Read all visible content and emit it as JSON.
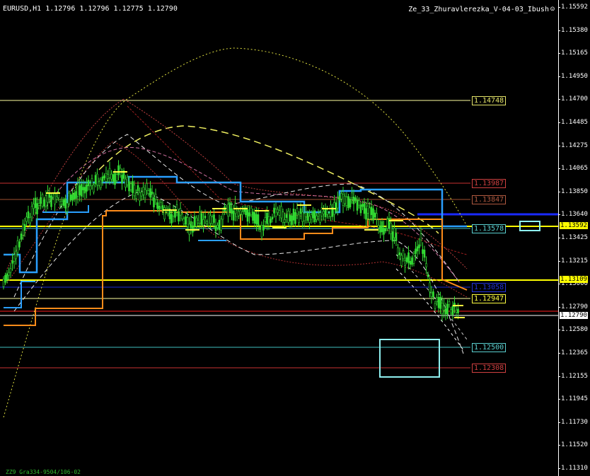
{
  "header": {
    "symbol_info": "EURUSD,H1  1.12796 1.12796 1.12775 1.12790",
    "indicator_name": "Ze_33_Zhuravlerezka_V-04-03_Ibush",
    "smiley_icon": "smiley-icon"
  },
  "footer": {
    "text": "ZZ9 Gra334-9504/106-02"
  },
  "price_axis": {
    "ticks": [
      "1.15592",
      "1.15380",
      "1.15165",
      "1.14950",
      "1.14700",
      "1.14485",
      "1.14275",
      "1.14065",
      "1.13850",
      "1.13640",
      "1.13425",
      "1.13215",
      "1.13000",
      "1.12790",
      "1.12580",
      "1.12365",
      "1.12155",
      "1.11945",
      "1.11730",
      "1.11520",
      "1.11310"
    ],
    "tag_high": "1.13592",
    "tag_yellow": "1.13109",
    "tag_current": "1.12790"
  },
  "level_labels": [
    {
      "text": "1.14748",
      "color": "#e6e66a"
    },
    {
      "text": "1.13987",
      "color": "#d04040"
    },
    {
      "text": "1.13847",
      "color": "#b05a40"
    },
    {
      "text": "1.13578",
      "color": "#5ad0d0"
    },
    {
      "text": "1.13058",
      "color": "#2233dd"
    },
    {
      "text": "1.12947",
      "color": "#ffff40"
    },
    {
      "text": "1.12500",
      "color": "#5ad0d0"
    },
    {
      "text": "1.12308",
      "color": "#d04040"
    }
  ],
  "colors": {
    "background": "#000000",
    "candles": "#33dd33",
    "grid": "#ffffff",
    "accent_blue": "#2a9fff",
    "accent_orange": "#ff8c1a",
    "accent_yellow": "#ffff00",
    "accent_cyan": "#8ff0f0"
  }
}
